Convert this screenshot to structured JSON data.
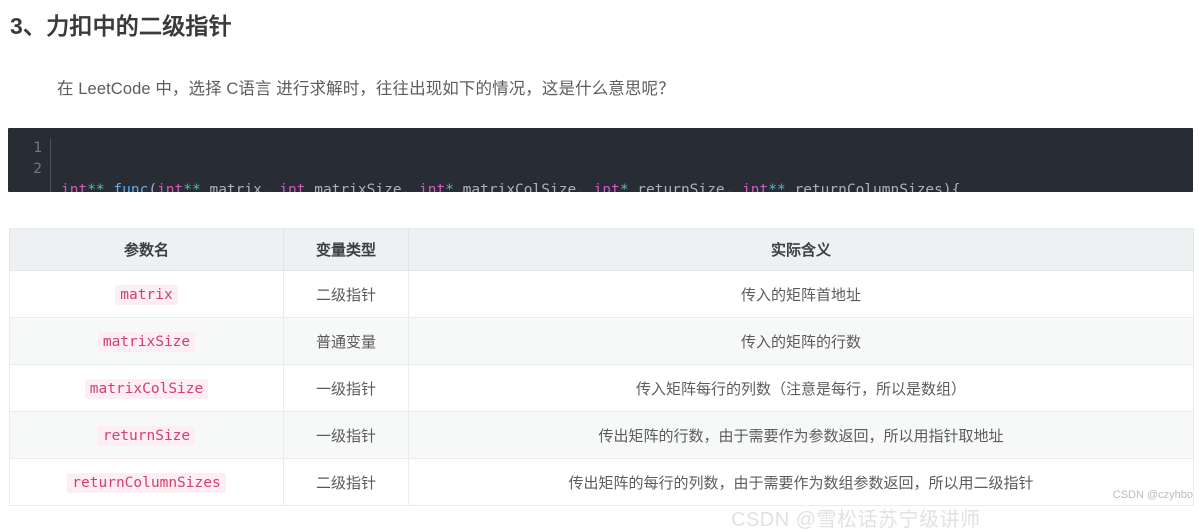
{
  "page": {
    "heading": "3、力扣中的二级指针",
    "intro": "在 LeetCode 中，选择 C语言 进行求解时，往往出现如下的情况，这是什么意思呢？"
  },
  "code_block": {
    "language": "c",
    "line_numbers": [
      "1",
      "2"
    ],
    "line1_tokens": [
      {
        "text": "int",
        "type": "keyword"
      },
      {
        "text": "**",
        "type": "operator"
      },
      {
        "text": " ",
        "type": "plain"
      },
      {
        "text": "func",
        "type": "function"
      },
      {
        "text": "(",
        "type": "punctuation"
      },
      {
        "text": "int",
        "type": "keyword"
      },
      {
        "text": "**",
        "type": "operator"
      },
      {
        "text": " matrix, ",
        "type": "plain"
      },
      {
        "text": "int",
        "type": "keyword"
      },
      {
        "text": " matrixSize, ",
        "type": "plain"
      },
      {
        "text": "int",
        "type": "keyword"
      },
      {
        "text": "*",
        "type": "operator"
      },
      {
        "text": " matrixColSize, ",
        "type": "plain"
      },
      {
        "text": "int",
        "type": "keyword"
      },
      {
        "text": "*",
        "type": "operator"
      },
      {
        "text": " returnSize, ",
        "type": "plain"
      },
      {
        "text": "int",
        "type": "keyword"
      },
      {
        "text": "**",
        "type": "operator"
      },
      {
        "text": " returnColumnSizes){",
        "type": "plain"
      }
    ],
    "line2_tokens": [
      {
        "text": "}",
        "type": "punctuation"
      }
    ],
    "plain_text": "int** func(int** matrix, int matrixSize, int* matrixColSize, int* returnSize, int** returnColumnSizes){\n}"
  },
  "table": {
    "headers": [
      "参数名",
      "变量类型",
      "实际含义"
    ],
    "rows": [
      {
        "param": "matrix",
        "type": "二级指针",
        "meaning": "传入的矩阵首地址"
      },
      {
        "param": "matrixSize",
        "type": "普通变量",
        "meaning": "传入的矩阵的行数"
      },
      {
        "param": "matrixColSize",
        "type": "一级指针",
        "meaning": "传入矩阵每行的列数（注意是每行，所以是数组）"
      },
      {
        "param": "returnSize",
        "type": "一级指针",
        "meaning": "传出矩阵的行数，由于需要作为参数返回，所以用指针取地址"
      },
      {
        "param": "returnColumnSizes",
        "type": "二级指针",
        "meaning": "传出矩阵的每行的列数，由于需要作为数组参数返回，所以用二级指针"
      }
    ]
  },
  "watermarks": {
    "small": "CSDN @czyhbo",
    "large": "CSDN @雪松话苏宁级讲师"
  },
  "colors": {
    "code_background": "#282c35",
    "table_header_background": "#edf1f2",
    "inline_code_text": "#d4406a",
    "inline_code_background": "#fdeef3",
    "keyword": "#d45ac0",
    "function": "#61afef",
    "operator": "#56b6c2"
  }
}
